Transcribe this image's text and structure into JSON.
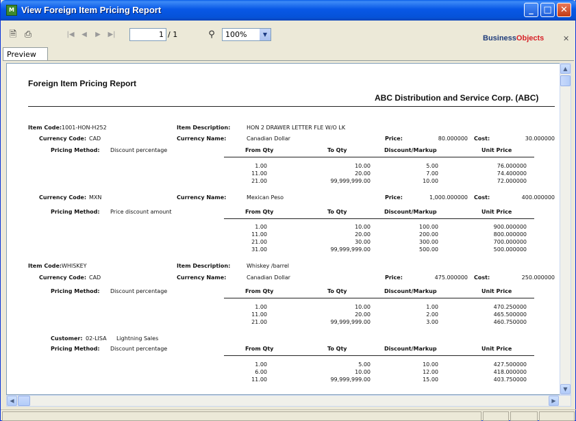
{
  "window": {
    "title": "View Foreign Item Pricing Report",
    "minimize": "_",
    "maximize": "□",
    "close": "✕"
  },
  "toolbar": {
    "export_icon": "export-icon",
    "print_icon": "printer-icon",
    "first": "|◀",
    "prev": "◀",
    "next": "▶",
    "last": "▶|",
    "page_current": "1",
    "page_total": "/ 1",
    "search_icon": "binoculars-icon",
    "zoom": "100%",
    "brand_a": "Business",
    "brand_b": "Objects",
    "close": "✕"
  },
  "tab": {
    "preview": "Preview"
  },
  "report": {
    "title": "Foreign Item Pricing Report",
    "company": "ABC Distribution and Service Corp. (ABC)",
    "labels": {
      "item_code": "Item Code:",
      "item_description": "Item Description:",
      "currency_code": "Currency Code:",
      "currency_name": "Currency Name:",
      "price": "Price:",
      "cost": "Cost:",
      "pricing_method": "Pricing Method:",
      "customer": "Customer:",
      "from_qty": "From Qty",
      "to_qty": "To Qty",
      "discount_markup": "Discount/Markup",
      "unit_price": "Unit Price"
    },
    "item1": {
      "code": "1001-HON-H252",
      "description": "HON 2 DRAWER LETTER FLE W/O LK",
      "cad": {
        "currency_code": "CAD",
        "currency_name": "Canadian Dollar",
        "price": "80.000000",
        "cost": "30.000000",
        "method": "Discount percentage",
        "rows": [
          {
            "from": "1.00",
            "to": "10.00",
            "disc": "5.00",
            "unit": "76.000000"
          },
          {
            "from": "11.00",
            "to": "20.00",
            "disc": "7.00",
            "unit": "74.400000"
          },
          {
            "from": "21.00",
            "to": "99,999,999.00",
            "disc": "10.00",
            "unit": "72.000000"
          }
        ]
      },
      "mxn": {
        "currency_code": "MXN",
        "currency_name": "Mexican Peso",
        "price": "1,000.000000",
        "cost": "400.000000",
        "method": "Price discount amount",
        "rows": [
          {
            "from": "1.00",
            "to": "10.00",
            "disc": "100.00",
            "unit": "900.000000"
          },
          {
            "from": "11.00",
            "to": "20.00",
            "disc": "200.00",
            "unit": "800.000000"
          },
          {
            "from": "21.00",
            "to": "30.00",
            "disc": "300.00",
            "unit": "700.000000"
          },
          {
            "from": "31.00",
            "to": "99,999,999.00",
            "disc": "500.00",
            "unit": "500.000000"
          }
        ]
      }
    },
    "item2": {
      "code": "WHISKEY",
      "description": "Whiskey /barrel",
      "cad": {
        "currency_code": "CAD",
        "currency_name": "Canadian Dollar",
        "price": "475.000000",
        "cost": "250.000000",
        "method": "Discount percentage",
        "rows": [
          {
            "from": "1.00",
            "to": "10.00",
            "disc": "1.00",
            "unit": "470.250000"
          },
          {
            "from": "11.00",
            "to": "20.00",
            "disc": "2.00",
            "unit": "465.500000"
          },
          {
            "from": "21.00",
            "to": "99,999,999.00",
            "disc": "3.00",
            "unit": "460.750000"
          }
        ]
      },
      "customer": {
        "id": "02-LISA",
        "name": "Lightning Sales",
        "method": "Discount percentage",
        "rows": [
          {
            "from": "1.00",
            "to": "5.00",
            "disc": "10.00",
            "unit": "427.500000"
          },
          {
            "from": "6.00",
            "to": "10.00",
            "disc": "12.00",
            "unit": "418.000000"
          },
          {
            "from": "11.00",
            "to": "99,999,999.00",
            "disc": "15.00",
            "unit": "403.750000"
          }
        ]
      }
    }
  }
}
